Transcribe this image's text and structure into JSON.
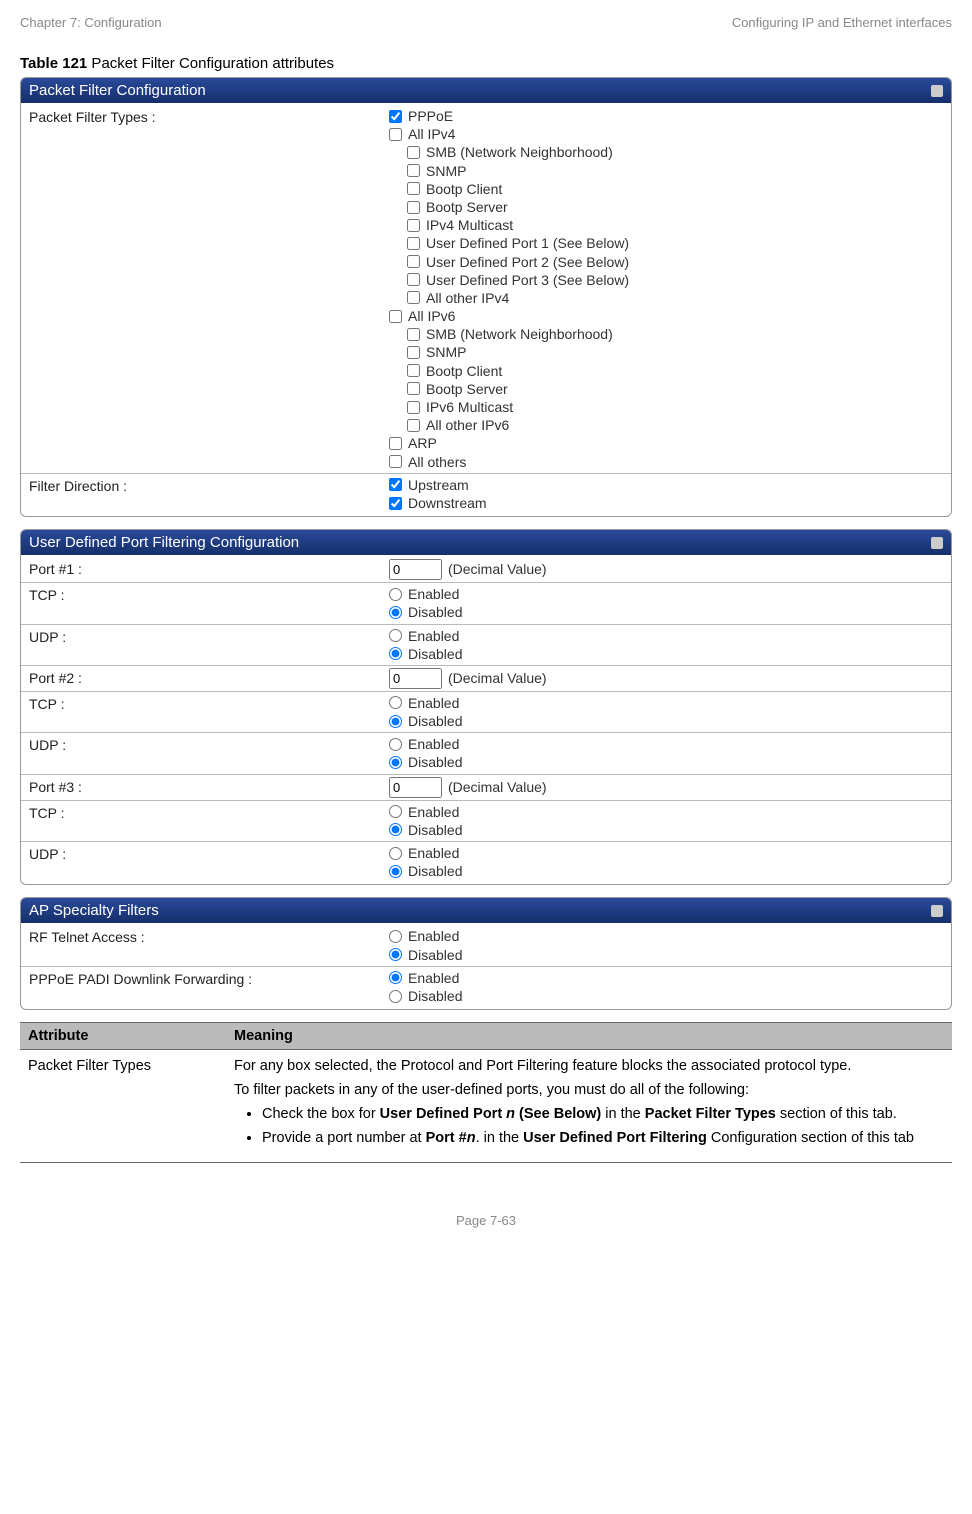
{
  "header": {
    "left": "Chapter 7:  Configuration",
    "right": "Configuring IP and Ethernet interfaces"
  },
  "caption": {
    "prefix": "Table 121",
    "rest": " Packet Filter Configuration attributes"
  },
  "panels": {
    "packetFilter": {
      "title": "Packet Filter Configuration",
      "row1Label": "Packet Filter Types :",
      "items": {
        "pppoe": "PPPoE",
        "allipv4": "All IPv4",
        "smb4": "SMB (Network Neighborhood)",
        "snmp4": "SNMP",
        "bootpc4": "Bootp Client",
        "bootps4": "Bootp Server",
        "ipv4mc": "IPv4 Multicast",
        "udp1": "User Defined Port 1 (See Below)",
        "udp2": "User Defined Port 2 (See Below)",
        "udp3": "User Defined Port 3 (See Below)",
        "allother4": "All other IPv4",
        "allipv6": "All IPv6",
        "smb6": "SMB (Network Neighborhood)",
        "snmp6": "SNMP",
        "bootpc6": "Bootp Client",
        "bootps6": "Bootp Server",
        "ipv6mc": "IPv6 Multicast",
        "allother6": "All other IPv6",
        "arp": "ARP",
        "allothers": "All others"
      },
      "row2Label": "Filter Direction :",
      "direction": {
        "up": "Upstream",
        "down": "Downstream"
      }
    },
    "userPort": {
      "title": "User Defined Port Filtering Configuration",
      "portLabel1": "Port #1 :",
      "portLabel2": "Port #2 :",
      "portLabel3": "Port #3 :",
      "tcpLabel": "TCP :",
      "udpLabel": "UDP :",
      "decimalHint": "(Decimal Value)",
      "portVal": "0",
      "enabled": "Enabled",
      "disabled": "Disabled"
    },
    "specialty": {
      "title": "AP Specialty Filters",
      "rfLabel": "RF Telnet Access :",
      "padiLabel": "PPPoE PADI Downlink Forwarding :",
      "enabled": "Enabled",
      "disabled": "Disabled"
    }
  },
  "attrTable": {
    "h1": "Attribute",
    "h2": "Meaning",
    "r1c1": "Packet Filter Types",
    "r1p1": "For any box selected, the Protocol and Port Filtering feature blocks the associated protocol type.",
    "r1p2": "To filter packets in any of the user-defined ports, you must do all of the following:",
    "r1li1a": "Check the box for ",
    "r1li1b": "User Defined Port ",
    "r1li1b_i": "n",
    "r1li1c": " (See Below)",
    "r1li1d": " in the ",
    "r1li1e": "Packet Filter Types",
    "r1li1f": " section of this tab.",
    "r1li2a": "Provide a port number at ",
    "r1li2b": "Port #",
    "r1li2b_i": "n",
    "r1li2c": ". in the ",
    "r1li2d": "User Defined Port Filtering",
    "r1li2e": " Configuration section of this tab"
  },
  "footer": "Page 7-63"
}
